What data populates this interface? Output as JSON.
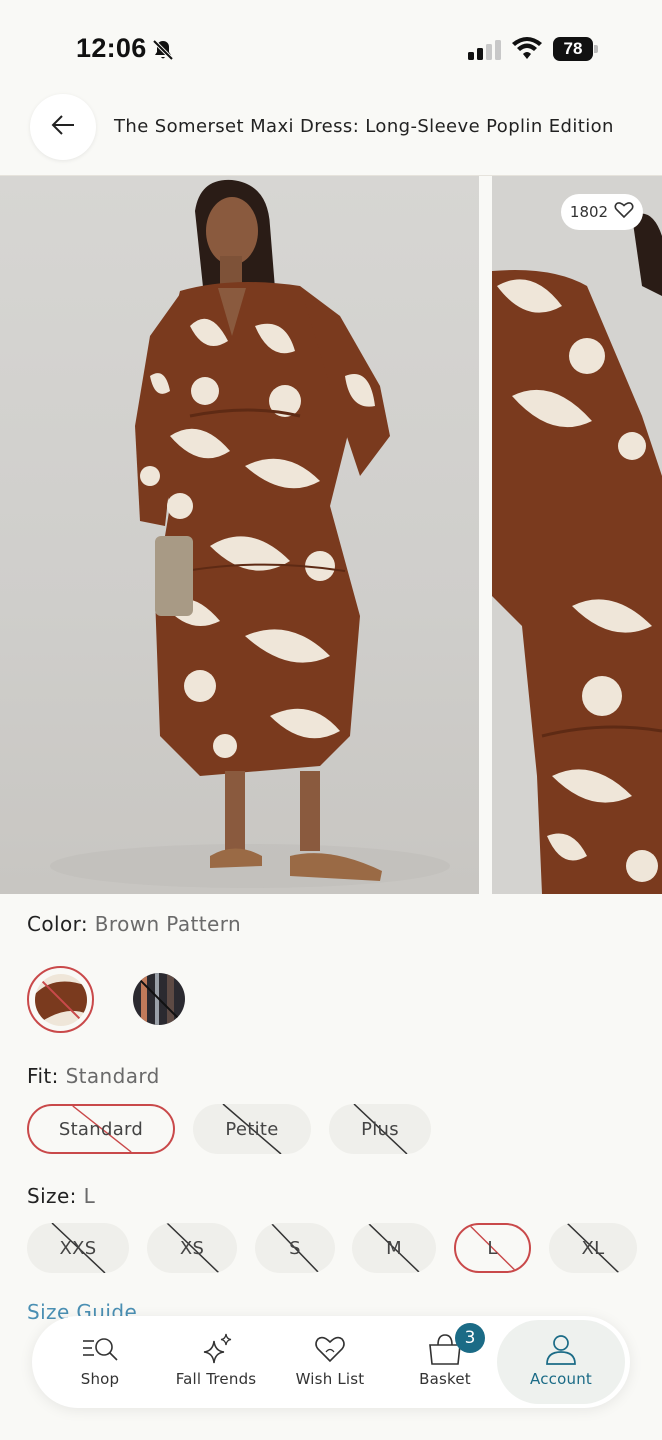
{
  "status_bar": {
    "time": "12:06",
    "battery": "78",
    "icons": [
      "bell-slash-icon",
      "cellular-signal-icon",
      "wifi-icon",
      "battery-icon"
    ]
  },
  "header": {
    "title": "The Somerset Maxi Dress: Long-Sleeve Poplin Edition",
    "back_icon": "arrow-left-icon"
  },
  "gallery": {
    "like_count": "1802",
    "like_icon": "heart-icon"
  },
  "color": {
    "label": "Color:",
    "value": "Brown Pattern"
  },
  "fit": {
    "label": "Fit:",
    "value": "Standard",
    "options": [
      "Standard",
      "Petite",
      "Plus"
    ]
  },
  "size": {
    "label": "Size:",
    "value": "L",
    "options": [
      "XXS",
      "XS",
      "S",
      "M",
      "L",
      "XL"
    ]
  },
  "size_guide": "Size Guide",
  "nav": {
    "items": [
      "Shop",
      "Fall Trends",
      "Wish List",
      "Basket",
      "Account"
    ],
    "basket_count": "3"
  },
  "colors": {
    "accent": "#1b6b86",
    "selected_border": "#c9494a",
    "link": "#4a8fb3"
  }
}
